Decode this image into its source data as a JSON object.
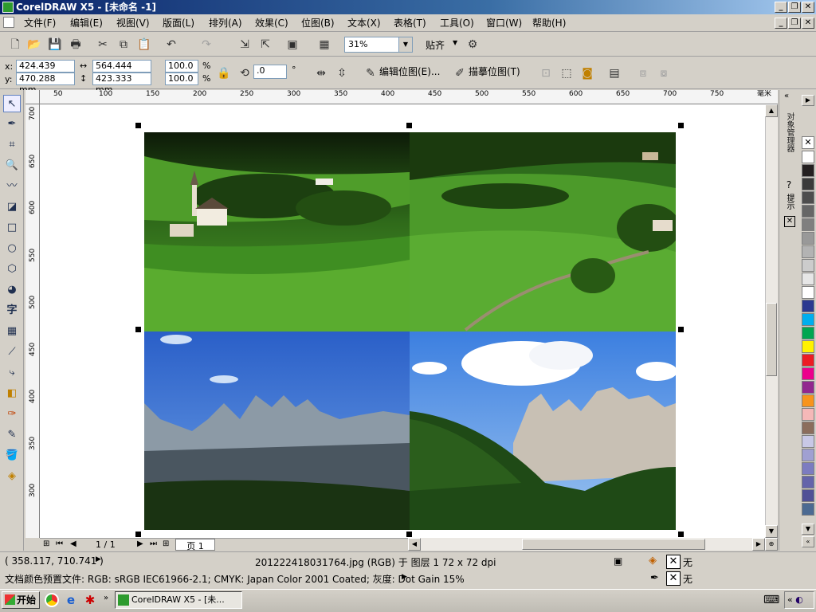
{
  "window": {
    "title": "CorelDRAW X5 - [未命名 -1]"
  },
  "menu": [
    "文件(F)",
    "编辑(E)",
    "视图(V)",
    "版面(L)",
    "排列(A)",
    "效果(C)",
    "位图(B)",
    "文本(X)",
    "表格(T)",
    "工具(O)",
    "窗口(W)",
    "帮助(H)"
  ],
  "toolbar": {
    "zoom": "31%",
    "snap_label": "贴齐"
  },
  "property_bar": {
    "x_label": "x:",
    "y_label": "y:",
    "x_value": "424.439 mm",
    "y_value": "470.288 mm",
    "width_value": "564.444 mm",
    "height_value": "423.333 mm",
    "scale_x": "100.0",
    "scale_y": "100.0",
    "percent": "%",
    "rotation": ".0",
    "degree": "°",
    "edit_bitmap_label": "编辑位图(E)...",
    "trace_bitmap_label": "描摹位图(T)"
  },
  "ruler_top_ticks": [
    "50",
    "100",
    "150",
    "200",
    "250",
    "300",
    "350",
    "400",
    "450",
    "500",
    "550",
    "600",
    "650",
    "700",
    "750"
  ],
  "ruler_unit": "毫米",
  "ruler_left_ticks": [
    "700",
    "650",
    "600",
    "550",
    "500",
    "450",
    "400",
    "350",
    "300"
  ],
  "page_nav": {
    "counter": "1 / 1",
    "tab": "页 1"
  },
  "dockers": {
    "object_manager": "对象管理器",
    "hints": "提示"
  },
  "palette_colors": [
    "#ffffff",
    "#231f20",
    "#3a3a3a",
    "#4d4d4d",
    "#666666",
    "#7f7f7f",
    "#999999",
    "#b3b3b3",
    "#cccccc",
    "#e6e6e6",
    "#ffffff",
    "#2b3990",
    "#00aeef",
    "#00a651",
    "#fff200",
    "#ed1c24",
    "#ec008c",
    "#92278f",
    "#f7941d",
    "#f5b8b8",
    "#8b6d5c",
    "#c8c8e6",
    "#a0a0d2",
    "#7c7cc0",
    "#6464aa",
    "#505096",
    "#4c6a92"
  ],
  "status": {
    "coords": "( 358.117, 710.741 )",
    "object_info": "201222418031764.jpg (RGB) 于 图层 1 72 x 72 dpi",
    "color_profile": "文档颜色预置文件: RGB: sRGB IEC61966-2.1; CMYK: Japan Color 2001 Coated; 灰度: Dot Gain 15%",
    "fill_none": "无",
    "outline_none": "无"
  },
  "taskbar": {
    "start": "开始",
    "task": "CorelDRAW X5 - [未..."
  }
}
